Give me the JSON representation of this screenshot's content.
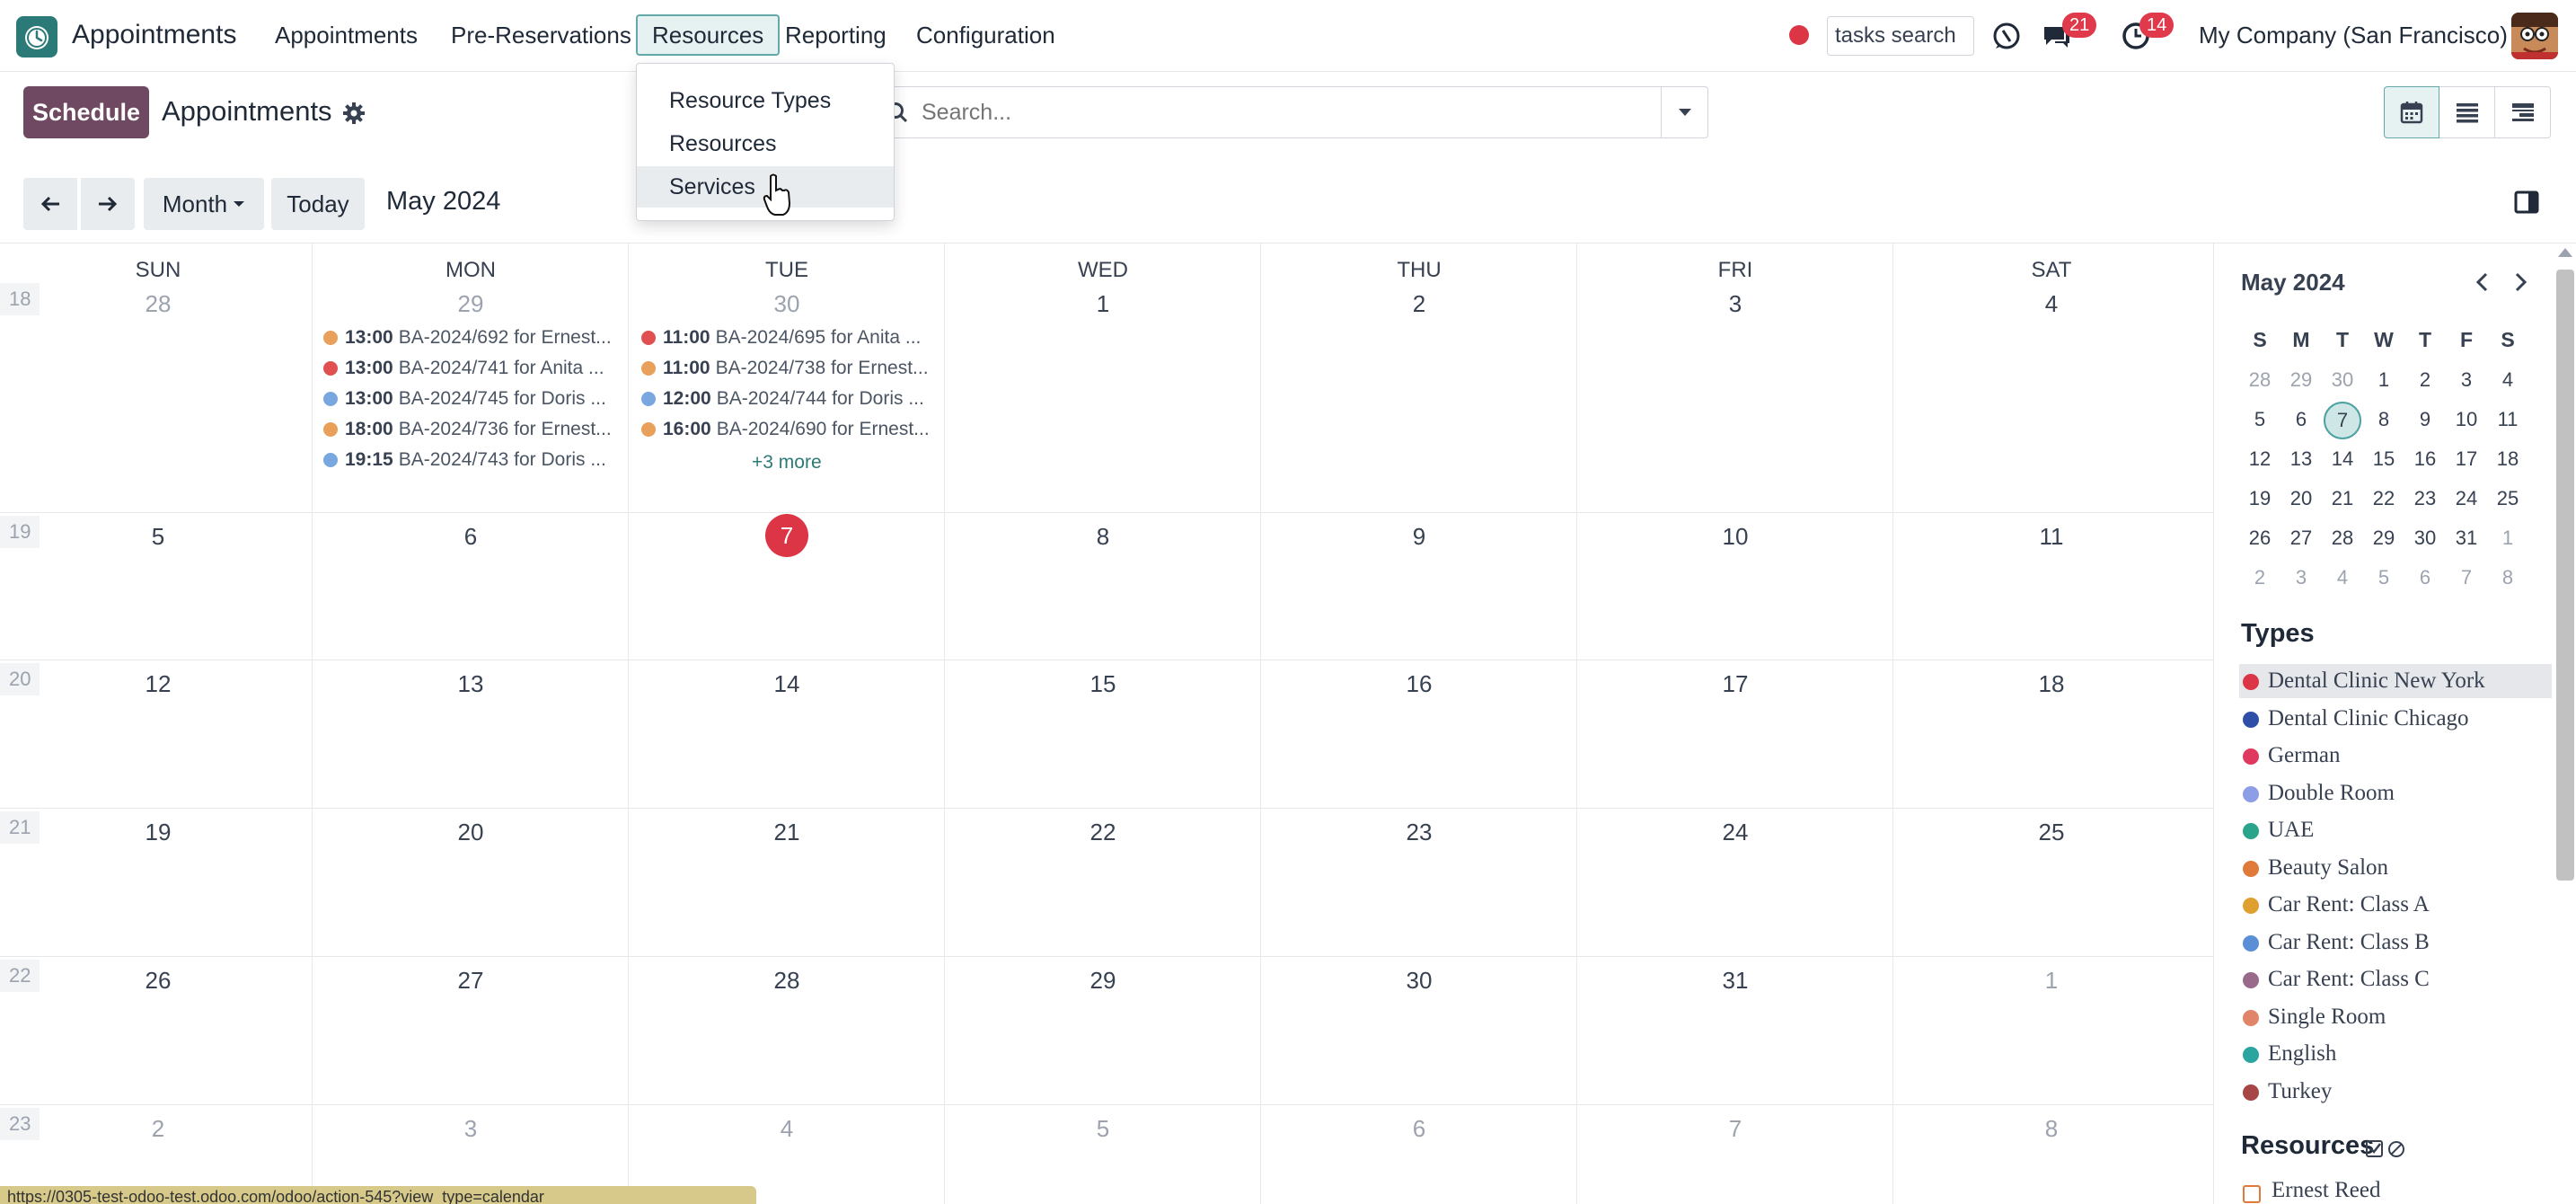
{
  "app": {
    "title": "Appointments"
  },
  "nav": {
    "items": [
      {
        "label": "Appointments"
      },
      {
        "label": "Pre-Reservations"
      },
      {
        "label": "Resources"
      },
      {
        "label": "Reporting"
      },
      {
        "label": "Configuration"
      }
    ],
    "tasks_search_value": "tasks search",
    "discuss_badge": "21",
    "activity_badge": "14",
    "company": "My Company (San Francisco)"
  },
  "resources_menu": {
    "items": [
      {
        "label": "Resource Types"
      },
      {
        "label": "Resources"
      },
      {
        "label": "Services"
      }
    ]
  },
  "control": {
    "schedule_label": "Schedule",
    "breadcrumb": "Appointments",
    "search_placeholder": "Search..."
  },
  "toolbar": {
    "scale_label": "Month",
    "today_label": "Today",
    "period": "May 2024"
  },
  "calendar": {
    "weekdays": [
      "SUN",
      "MON",
      "TUE",
      "WED",
      "THU",
      "FRI",
      "SAT"
    ],
    "weeks": [
      {
        "num": "18",
        "days": [
          "28",
          "29",
          "30",
          "1",
          "2",
          "3",
          "4"
        ]
      },
      {
        "num": "19",
        "days": [
          "5",
          "6",
          "7",
          "8",
          "9",
          "10",
          "11"
        ]
      },
      {
        "num": "20",
        "days": [
          "12",
          "13",
          "14",
          "15",
          "16",
          "17",
          "18"
        ]
      },
      {
        "num": "21",
        "days": [
          "19",
          "20",
          "21",
          "22",
          "23",
          "24",
          "25"
        ]
      },
      {
        "num": "22",
        "days": [
          "26",
          "27",
          "28",
          "29",
          "30",
          "31",
          "1"
        ]
      },
      {
        "num": "23",
        "days": [
          "2",
          "3",
          "4",
          "5",
          "6",
          "7",
          "8"
        ]
      }
    ],
    "events_mon": [
      {
        "time": "13:00",
        "title": "BA-2024/692 for Ernest...",
        "color": "#e8a05a"
      },
      {
        "time": "13:00",
        "title": "BA-2024/741 for Anita ...",
        "color": "#e05050"
      },
      {
        "time": "13:00",
        "title": "BA-2024/745 for Doris ...",
        "color": "#7aa7e0"
      },
      {
        "time": "18:00",
        "title": "BA-2024/736 for Ernest...",
        "color": "#e8a05a"
      },
      {
        "time": "19:15",
        "title": "BA-2024/743 for Doris ...",
        "color": "#7aa7e0"
      }
    ],
    "events_tue": [
      {
        "time": "11:00",
        "title": "BA-2024/695 for Anita ...",
        "color": "#e05050"
      },
      {
        "time": "11:00",
        "title": "BA-2024/738 for Ernest...",
        "color": "#e8a05a"
      },
      {
        "time": "12:00",
        "title": "BA-2024/744 for Doris ...",
        "color": "#7aa7e0"
      },
      {
        "time": "16:00",
        "title": "BA-2024/690 for Ernest...",
        "color": "#e8a05a"
      }
    ],
    "tue_more": "+3 more"
  },
  "mini_calendar": {
    "title": "May 2024",
    "weekdays": [
      "S",
      "M",
      "T",
      "W",
      "T",
      "F",
      "S"
    ],
    "weeks": [
      [
        "28",
        "29",
        "30",
        "1",
        "2",
        "3",
        "4"
      ],
      [
        "5",
        "6",
        "7",
        "8",
        "9",
        "10",
        "11"
      ],
      [
        "12",
        "13",
        "14",
        "15",
        "16",
        "17",
        "18"
      ],
      [
        "19",
        "20",
        "21",
        "22",
        "23",
        "24",
        "25"
      ],
      [
        "26",
        "27",
        "28",
        "29",
        "30",
        "31",
        "1"
      ],
      [
        "2",
        "3",
        "4",
        "5",
        "6",
        "7",
        "8"
      ]
    ]
  },
  "types": {
    "title": "Types",
    "items": [
      {
        "label": "Dental Clinic New York",
        "color": "#dc3545"
      },
      {
        "label": "Dental Clinic Chicago",
        "color": "#2d4fa8"
      },
      {
        "label": "German",
        "color": "#e0395f"
      },
      {
        "label": "Double Room",
        "color": "#8b9ee6"
      },
      {
        "label": "UAE",
        "color": "#2aa58c"
      },
      {
        "label": "Beauty Salon",
        "color": "#e07a3a"
      },
      {
        "label": "Car Rent: Class A",
        "color": "#e0a030"
      },
      {
        "label": "Car Rent: Class B",
        "color": "#5a8fd6"
      },
      {
        "label": "Car Rent: Class C",
        "color": "#9a6a8a"
      },
      {
        "label": "Single Room",
        "color": "#e0856a"
      },
      {
        "label": "English",
        "color": "#2aa5a0"
      },
      {
        "label": "Turkey",
        "color": "#a84545"
      }
    ]
  },
  "resources": {
    "title": "Resources",
    "first": "Ernest Reed"
  },
  "status_url": "https://0305-test-odoo-test.odoo.com/odoo/action-545?view_type=calendar"
}
